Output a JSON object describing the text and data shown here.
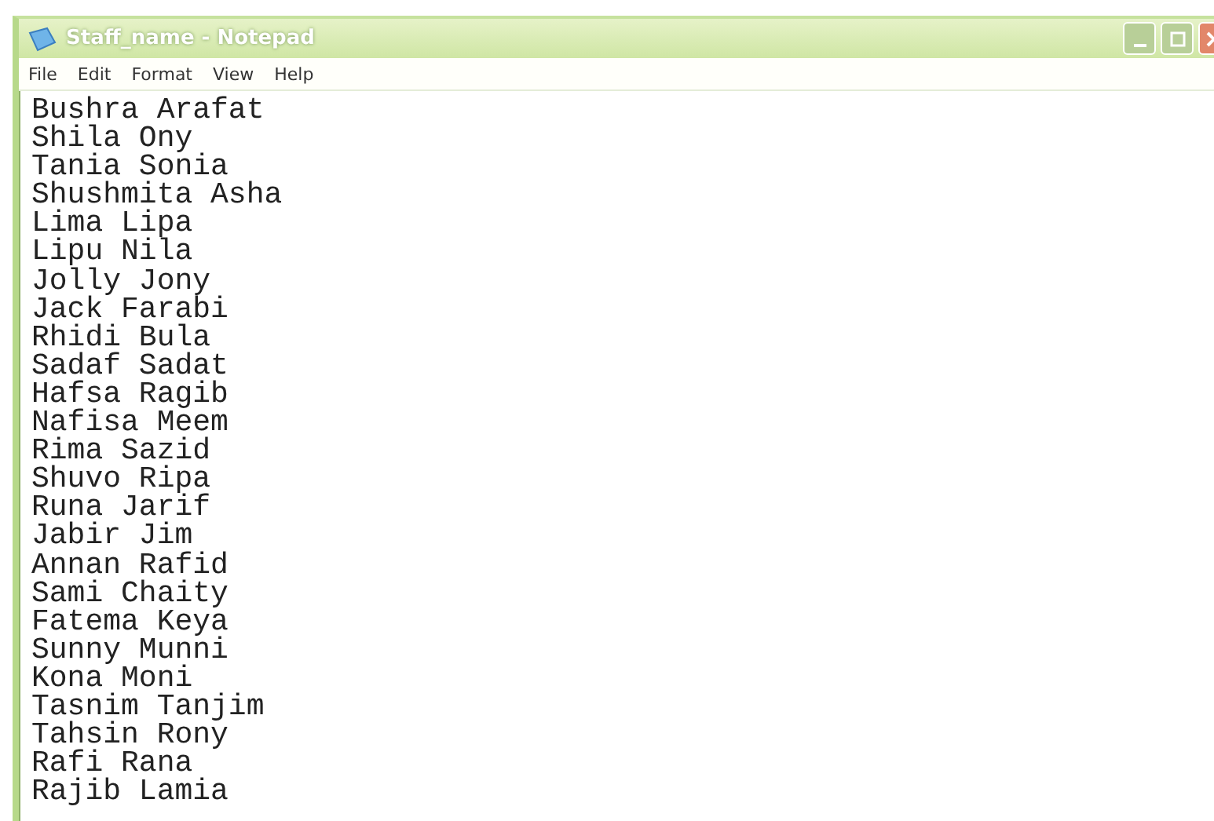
{
  "window": {
    "title": "Staff_name - Notepad"
  },
  "menu": [
    "File",
    "Edit",
    "Format",
    "View",
    "Help"
  ],
  "lines": [
    "Bushra Arafat",
    "Shila Ony",
    "Tania Sonia",
    "Shushmita Asha",
    "Lima Lipa",
    "Lipu Nila",
    "Jolly Jony",
    "Jack Farabi",
    "Rhidi Bula",
    "Sadaf Sadat",
    "Hafsa Ragib",
    "Nafisa Meem",
    "Rima Sazid",
    "Shuvo Ripa",
    "Runa Jarif",
    "Jabir Jim",
    "Annan Rafid",
    "Sami Chaity",
    "Fatema Keya",
    "Sunny Munni",
    "Kona Moni",
    "Tasnim Tanjim",
    "Tahsin Rony",
    "Rafi Rana",
    "Rajib Lamia"
  ]
}
